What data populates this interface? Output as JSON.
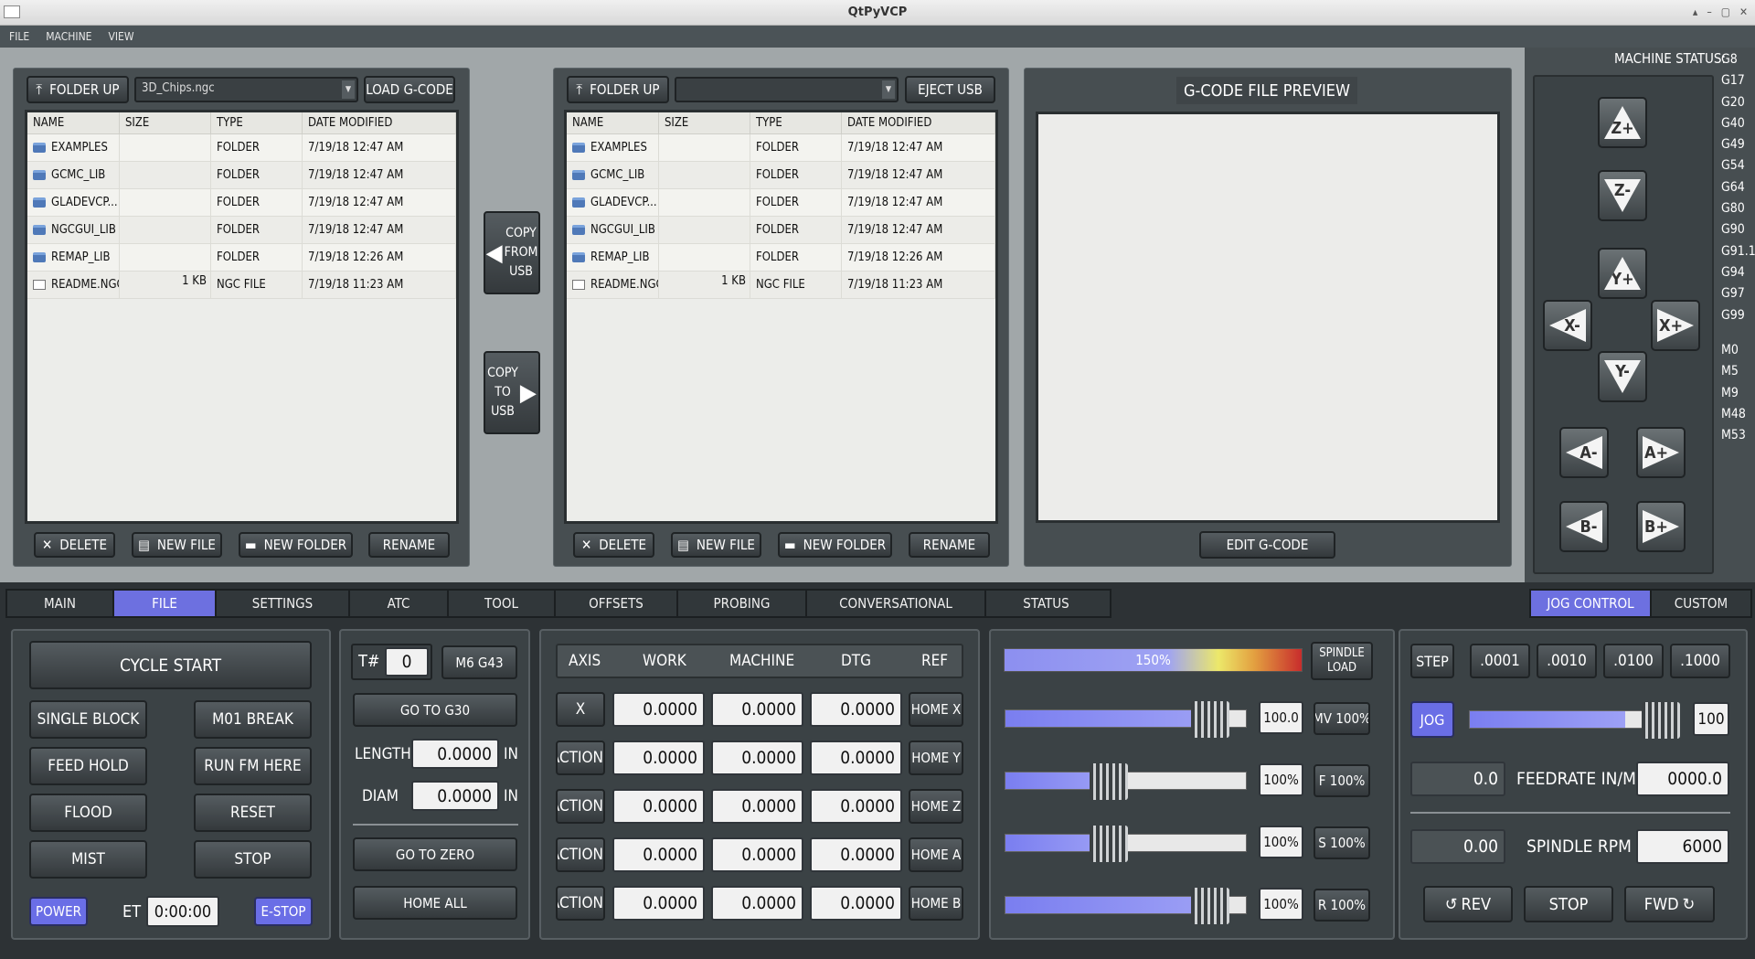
{
  "window": {
    "title": "QtPyVCP"
  },
  "menu": [
    "FILE",
    "MACHINE",
    "VIEW"
  ],
  "left_browser": {
    "folder_up": "FOLDER UP",
    "combo": "3D_Chips.ngc",
    "load": "LOAD G-CODE",
    "columns": [
      "NAME",
      "SIZE",
      "TYPE",
      "DATE MODIFIED"
    ],
    "rows": [
      [
        "EXAMPLES",
        "",
        "FOLDER",
        "7/19/18 12:47 AM"
      ],
      [
        "GCMC_LIB",
        "",
        "FOLDER",
        "7/19/18 12:47 AM"
      ],
      [
        "GLADEVCP...",
        "",
        "FOLDER",
        "7/19/18 12:47 AM"
      ],
      [
        "NGCGUI_LIB",
        "",
        "FOLDER",
        "7/19/18 12:47 AM"
      ],
      [
        "REMAP_LIB",
        "",
        "FOLDER",
        "7/19/18 12:26 AM"
      ],
      [
        "README.NGC",
        "1 KB",
        "NGC FILE",
        "7/19/18 11:23 AM"
      ]
    ],
    "delete": "DELETE",
    "new_file": "NEW FILE",
    "new_folder": "NEW FOLDER",
    "rename": "RENAME"
  },
  "copy_from_usb": [
    "COPY",
    "FROM",
    "USB"
  ],
  "copy_to_usb": [
    "COPY",
    "TO",
    "USB"
  ],
  "right_browser": {
    "folder_up": "FOLDER UP",
    "combo": "",
    "eject": "EJECT USB",
    "columns": [
      "NAME",
      "SIZE",
      "TYPE",
      "DATE MODIFIED"
    ],
    "rows": [
      [
        "EXAMPLES",
        "",
        "FOLDER",
        "7/19/18 12:47 AM"
      ],
      [
        "GCMC_LIB",
        "",
        "FOLDER",
        "7/19/18 12:47 AM"
      ],
      [
        "GLADEVCP...",
        "",
        "FOLDER",
        "7/19/18 12:47 AM"
      ],
      [
        "NGCGUI_LIB",
        "",
        "FOLDER",
        "7/19/18 12:47 AM"
      ],
      [
        "REMAP_LIB",
        "",
        "FOLDER",
        "7/19/18 12:26 AM"
      ],
      [
        "README.NGC",
        "1 KB",
        "NGC FILE",
        "7/19/18 11:23 AM"
      ]
    ],
    "delete": "DELETE",
    "new_file": "NEW FILE",
    "new_folder": "NEW FOLDER",
    "rename": "RENAME"
  },
  "preview": {
    "title": "G-CODE FILE PREVIEW",
    "edit": "EDIT G-CODE"
  },
  "machine_status": {
    "label": "MACHINE STATUS:",
    "gcodes": [
      "G8",
      "G17",
      "G20",
      "G40",
      "G49",
      "G54",
      "G64",
      "G80",
      "G90",
      "G91.1",
      "G94",
      "G97",
      "G99"
    ],
    "mcodes": [
      "M0",
      "M5",
      "M9",
      "M48",
      "M53"
    ]
  },
  "jog_buttons": [
    "Z+",
    "Z-",
    "Y+",
    "X-",
    "X+",
    "Y-",
    "A-",
    "A+",
    "B-",
    "B+"
  ],
  "tabs": [
    "MAIN",
    "FILE",
    "SETTINGS",
    "ATC",
    "TOOL",
    "OFFSETS",
    "PROBING",
    "CONVERSATIONAL",
    "STATUS"
  ],
  "active_tab": "FILE",
  "right_tabs": [
    "JOG CONTROL",
    "CUSTOM"
  ],
  "program": {
    "cycle_start": "CYCLE START",
    "single_block": "SINGLE BLOCK",
    "m01_break": "M01 BREAK",
    "feed_hold": "FEED HOLD",
    "run_fm_here": "RUN FM HERE",
    "flood": "FLOOD",
    "reset": "RESET",
    "mist": "MIST",
    "stop": "STOP",
    "power": "POWER",
    "et_label": "ET",
    "et_value": "0:00:00",
    "estop": "E-STOP"
  },
  "tool": {
    "t_label": "T#",
    "t_value": "0",
    "m6": "M6 G43",
    "go_g30": "GO TO G30",
    "length_label": "LENGTH",
    "length_value": "0.0000",
    "length_unit": "IN",
    "diam_label": "DIAM",
    "diam_value": "0.0000",
    "diam_unit": "IN",
    "go_zero": "GO TO ZERO",
    "home_all": "HOME ALL"
  },
  "dro": {
    "headers": [
      "AXIS",
      "WORK",
      "MACHINE",
      "DTG",
      "REF"
    ],
    "rows": [
      {
        "axis": "X",
        "work": "0.0000",
        "machine": "0.0000",
        "dtg": "0.0000",
        "home": "HOME X"
      },
      {
        "axis": "ACTION",
        "work": "0.0000",
        "machine": "0.0000",
        "dtg": "0.0000",
        "home": "HOME Y"
      },
      {
        "axis": "ACTION",
        "work": "0.0000",
        "machine": "0.0000",
        "dtg": "0.0000",
        "home": "HOME Z"
      },
      {
        "axis": "ACTION",
        "work": "0.0000",
        "machine": "0.0000",
        "dtg": "0.0000",
        "home": "HOME A"
      },
      {
        "axis": "ACTION",
        "work": "0.0000",
        "machine": "0.0000",
        "dtg": "0.0000",
        "home": "HOME B"
      }
    ]
  },
  "overrides": {
    "load_text": "150%",
    "spindle_load": [
      "SPINDLE",
      "LOAD"
    ],
    "rows": [
      {
        "value": "100.0",
        "btn": "MV 100%",
        "fill": 0.85
      },
      {
        "value": "100%",
        "btn": "F 100%",
        "fill": 0.43
      },
      {
        "value": "100%",
        "btn": "S 100%",
        "fill": 0.43
      },
      {
        "value": "100%",
        "btn": "R 100%",
        "fill": 0.85
      }
    ]
  },
  "jog": {
    "step": "STEP",
    "steps": [
      ".0001",
      ".0010",
      ".0100",
      ".1000"
    ],
    "jog": "JOG",
    "jog_value": "100",
    "feed_value": "0.0",
    "feed_label": "FEEDRATE IN/M",
    "feed_set": "0000.0",
    "rpm_value": "0.00",
    "rpm_label": "SPINDLE RPM",
    "rpm_set": "6000",
    "rev": "REV",
    "stop": "STOP",
    "fwd": "FWD"
  },
  "colors": {
    "accent": "#6a6ee6",
    "background": "#2d3235",
    "panel": "#474e51"
  }
}
